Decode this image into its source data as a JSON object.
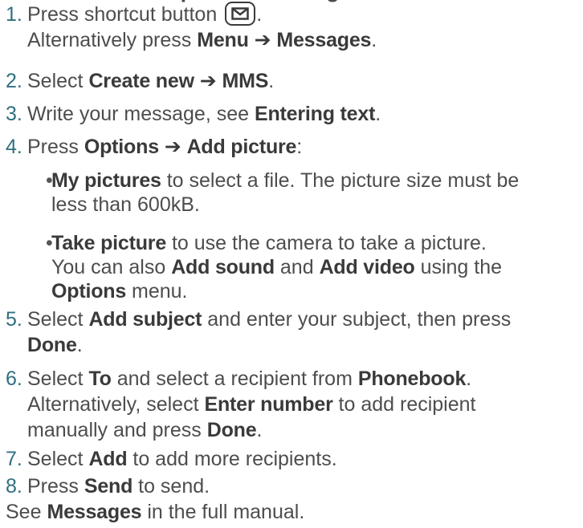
{
  "title": "Create and send picture messages",
  "icon": "envelope-icon",
  "steps": [
    {
      "num": "1.",
      "a": "Press shortcut button",
      "b": ".",
      "c": "Alternatively press",
      "d": "Menu",
      "e": "➔",
      "f": "Messages",
      "g": "."
    },
    {
      "num": "2.",
      "a": "Select",
      "b": "Create new",
      "c": "➔",
      "d": "MMS",
      "e": "."
    },
    {
      "num": "3.",
      "a": "Write your message, see",
      "b": "Entering text",
      "c": "."
    },
    {
      "num": "4.",
      "a": "Press",
      "b": "Options",
      "c": "➔",
      "d": "Add picture",
      "e": ":"
    },
    {
      "num": "5.",
      "a": "Select",
      "b": "Add subject",
      "c": "and enter your subject, then press",
      "d": "Done",
      "e": "."
    },
    {
      "num": "6.",
      "a": "Select",
      "b": "To",
      "c": "and select a recipient from",
      "d": "Phonebook",
      "e": ".",
      "f": "Alternatively, select",
      "g": "Enter number",
      "h": "to add recipient",
      "i": "manually and press",
      "j": "Done",
      "k": "."
    },
    {
      "num": "7.",
      "a": "Select",
      "b": "Add",
      "c": "to add more recipients."
    },
    {
      "num": "8.",
      "a": "Press",
      "b": "Send",
      "c": "to send."
    }
  ],
  "bullets": [
    {
      "mark": "•",
      "a": "My pictures",
      "b": "to select a file. The picture size must be",
      "c": "less than 600kB."
    },
    {
      "mark": "•",
      "a": "Take picture",
      "b": "to use the camera to take a picture.",
      "c": "You can also",
      "d": "Add sound",
      "e": "and",
      "f": "Add video",
      "g": "using the",
      "h": "Options",
      "i": "menu."
    }
  ],
  "footer": {
    "a": "See",
    "b": "Messages",
    "c": "in the full manual."
  }
}
